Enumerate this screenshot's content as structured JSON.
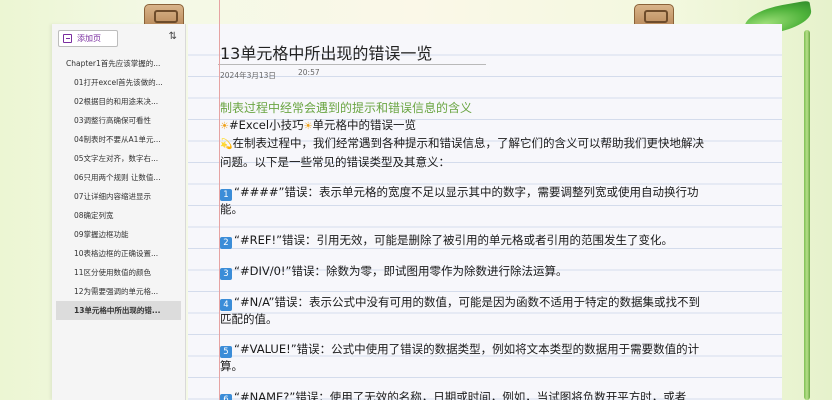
{
  "sidebar": {
    "add_page_label": "添加页",
    "sort_icon": "sort-icon",
    "pages": [
      {
        "label": "Chapter1首先应该掌握的...",
        "level": 0,
        "active": false
      },
      {
        "label": "01打开excel首先该做的...",
        "level": 1,
        "active": false
      },
      {
        "label": "02根据目的和用途来决...",
        "level": 1,
        "active": false
      },
      {
        "label": "03调整行高确保可看性",
        "level": 1,
        "active": false
      },
      {
        "label": "04制表时不要从A1单元...",
        "level": 1,
        "active": false
      },
      {
        "label": "05文字左对齐，数字右...",
        "level": 1,
        "active": false
      },
      {
        "label": "06只用两个规则 让数值...",
        "level": 1,
        "active": false
      },
      {
        "label": "07让详细内容缩进显示",
        "level": 1,
        "active": false
      },
      {
        "label": "08确定列宽",
        "level": 1,
        "active": false
      },
      {
        "label": "09掌握边框功能",
        "level": 1,
        "active": false
      },
      {
        "label": "10表格边框的正确设置...",
        "level": 1,
        "active": false
      },
      {
        "label": "11区分使用数值的颜色",
        "level": 1,
        "active": false
      },
      {
        "label": "12为需要强调的单元格...",
        "level": 1,
        "active": false
      },
      {
        "label": "13单元格中所出现的错...",
        "level": 1,
        "active": true
      }
    ]
  },
  "page": {
    "title": "13单元格中所出现的错误一览",
    "date": "2024年3月13日",
    "time": "20:57",
    "heading": "制表过程中经常会遇到的提示和错误信息的含义",
    "tip_line": "#Excel小技巧",
    "tip_line_tail": "单元格中的错误一览",
    "intro": "在制表过程中，我们经常遇到各种提示和错误信息，了解它们的含义可以帮助我们更快地解决问题。以下是一些常见的错误类型及其意义：",
    "errors": [
      {
        "num": "1",
        "text": "“####”错误：表示单元格的宽度不足以显示其中的数字，需要调整列宽或使用自动换行功能。"
      },
      {
        "num": "2",
        "text": "“#REF!”错误：引用无效，可能是删除了被引用的单元格或者引用的范围发生了变化。"
      },
      {
        "num": "3",
        "text": "“#DIV/0!”错误：除数为零，即试图用零作为除数进行除法运算。"
      },
      {
        "num": "4",
        "text": "“#N/A”错误：表示公式中没有可用的数值，可能是因为函数不适用于特定的数据集或找不到匹配的值。"
      },
      {
        "num": "5",
        "text": "“#VALUE!”错误：公式中使用了错误的数据类型，例如将文本类型的数据用于需要数值的计算。"
      },
      {
        "num": "6",
        "text": "“#NAME?”错误：使用了无效的名称，日期或时间，例如，当试图将负数开平方时，或者"
      }
    ]
  },
  "colors": {
    "heading": "#6aa542",
    "keycap": "#3b8dd8",
    "accent_purple": "#7a2ea0",
    "margin_line": "#e6a3a3"
  }
}
